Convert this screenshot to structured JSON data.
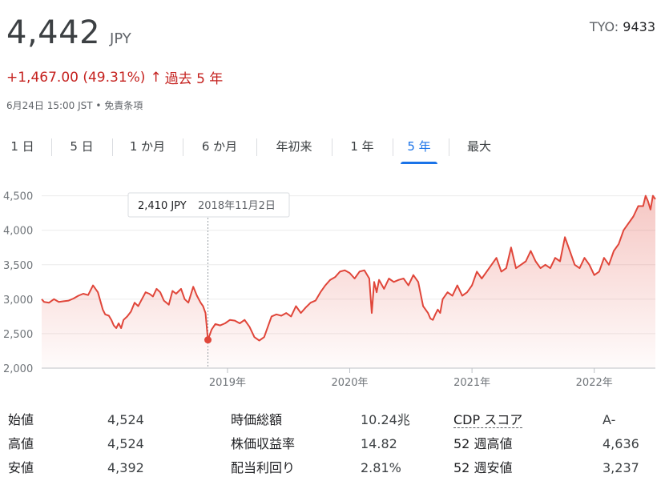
{
  "header": {
    "price": "4,442",
    "currency": "JPY",
    "ticker_exchange": "TYO: ",
    "ticker_code": "9433",
    "change": "+1,467.00 (49.31%)",
    "change_arrow": "↑",
    "change_period": "過去 5 年",
    "timestamp": "6月24日 15:00 JST • 免責条項"
  },
  "tabs": [
    {
      "label": "1 日",
      "active": false
    },
    {
      "label": "5 日",
      "active": false
    },
    {
      "label": "1 か月",
      "active": false
    },
    {
      "label": "6 か月",
      "active": false
    },
    {
      "label": "年初来",
      "active": false
    },
    {
      "label": "1 年",
      "active": false
    },
    {
      "label": "5 年",
      "active": true
    },
    {
      "label": "最大",
      "active": false
    }
  ],
  "tooltip": {
    "price": "2,410 JPY",
    "date": "2018年11月2日"
  },
  "colors": {
    "line": "#e0463a",
    "accent": "#1a73e8",
    "negative_text": "#c5221f"
  },
  "chart_data": {
    "type": "area",
    "yticks": [
      2000,
      2500,
      3000,
      3500,
      4000,
      4500
    ],
    "ytick_labels": [
      "2,000",
      "2,500",
      "3,000",
      "3,500",
      "4,000",
      "4,500"
    ],
    "xtick_labels": [
      "2019年",
      "2020年",
      "2021年",
      "2022年"
    ],
    "xticks": [
      2019.0,
      2020.0,
      2021.0,
      2022.0
    ],
    "xlim": [
      2017.48,
      2022.5
    ],
    "ylim": [
      2000,
      4600
    ],
    "grid": true,
    "highlight": {
      "x": 2018.84,
      "y": 2410
    },
    "series": [
      {
        "x": [
          2017.48,
          2017.5,
          2017.54,
          2017.58,
          2017.62,
          2017.66,
          2017.7,
          2017.74,
          2017.78,
          2017.82,
          2017.86,
          2017.9,
          2017.94,
          2017.98,
          2018.0,
          2018.03,
          2018.05,
          2018.07,
          2018.09,
          2018.11,
          2018.13,
          2018.15,
          2018.18,
          2018.21,
          2018.24,
          2018.27,
          2018.3,
          2018.33,
          2018.36,
          2018.39,
          2018.42,
          2018.45,
          2018.48,
          2018.52,
          2018.55,
          2018.58,
          2018.62,
          2018.65,
          2018.68,
          2018.72,
          2018.75,
          2018.78,
          2018.8,
          2018.82,
          2018.84,
          2018.87,
          2018.9,
          2018.94,
          2018.98,
          2019.02,
          2019.06,
          2019.1,
          2019.14,
          2019.18,
          2019.22,
          2019.26,
          2019.3,
          2019.33,
          2019.36,
          2019.4,
          2019.44,
          2019.48,
          2019.52,
          2019.56,
          2019.6,
          2019.64,
          2019.68,
          2019.72,
          2019.76,
          2019.8,
          2019.84,
          2019.88,
          2019.92,
          2019.96,
          2020.0,
          2020.04,
          2020.08,
          2020.12,
          2020.16,
          2020.18,
          2020.2,
          2020.22,
          2020.24,
          2020.28,
          2020.32,
          2020.36,
          2020.4,
          2020.44,
          2020.48,
          2020.52,
          2020.56,
          2020.6,
          2020.64,
          2020.66,
          2020.68,
          2020.7,
          2020.72,
          2020.74,
          2020.76,
          2020.8,
          2020.84,
          2020.88,
          2020.92,
          2020.96,
          2021.0,
          2021.04,
          2021.08,
          2021.12,
          2021.16,
          2021.2,
          2021.24,
          2021.28,
          2021.32,
          2021.36,
          2021.4,
          2021.44,
          2021.48,
          2021.52,
          2021.56,
          2021.6,
          2021.64,
          2021.68,
          2021.72,
          2021.76,
          2021.8,
          2021.84,
          2021.88,
          2021.92,
          2021.96,
          2022.0,
          2022.04,
          2022.08,
          2022.12,
          2022.16,
          2022.2,
          2022.24,
          2022.28,
          2022.32,
          2022.36,
          2022.4,
          2022.42,
          2022.44,
          2022.46,
          2022.48,
          2022.5
        ],
        "values": [
          3000,
          2960,
          2950,
          3000,
          2960,
          2970,
          2980,
          3010,
          3050,
          3080,
          3060,
          3200,
          3100,
          2850,
          2780,
          2760,
          2700,
          2620,
          2580,
          2650,
          2580,
          2700,
          2750,
          2820,
          2950,
          2900,
          3000,
          3100,
          3080,
          3040,
          3150,
          3100,
          2980,
          2920,
          3120,
          3080,
          3150,
          3000,
          2950,
          3180,
          3050,
          2950,
          2900,
          2800,
          2410,
          2560,
          2640,
          2620,
          2650,
          2700,
          2690,
          2650,
          2700,
          2600,
          2450,
          2400,
          2450,
          2600,
          2750,
          2780,
          2760,
          2800,
          2750,
          2900,
          2800,
          2880,
          2950,
          2980,
          3100,
          3200,
          3280,
          3320,
          3400,
          3420,
          3380,
          3300,
          3400,
          3420,
          3300,
          2800,
          3250,
          3100,
          3280,
          3150,
          3300,
          3250,
          3280,
          3300,
          3200,
          3350,
          3250,
          2900,
          2800,
          2720,
          2700,
          2780,
          2850,
          2800,
          3000,
          3100,
          3050,
          3200,
          3050,
          3100,
          3200,
          3400,
          3300,
          3400,
          3500,
          3600,
          3400,
          3450,
          3750,
          3450,
          3500,
          3550,
          3700,
          3550,
          3450,
          3500,
          3450,
          3600,
          3550,
          3900,
          3700,
          3500,
          3450,
          3600,
          3500,
          3350,
          3400,
          3600,
          3500,
          3700,
          3800,
          4000,
          4100,
          4200,
          4350,
          4350,
          4500,
          4420,
          4300,
          4500,
          4450
        ]
      }
    ]
  },
  "stats": [
    {
      "label": "始値",
      "value": "4,524"
    },
    {
      "label": "高値",
      "value": "4,524"
    },
    {
      "label": "安値",
      "value": "4,392"
    },
    {
      "label": "時価総額",
      "value": "10.24兆"
    },
    {
      "label": "株価収益率",
      "value": "14.82"
    },
    {
      "label": "配当利回り",
      "value": "2.81%"
    },
    {
      "label": "CDP スコア",
      "value": "A-"
    },
    {
      "label": "52 週高値",
      "value": "4,636"
    },
    {
      "label": "52 週安値",
      "value": "3,237"
    }
  ]
}
